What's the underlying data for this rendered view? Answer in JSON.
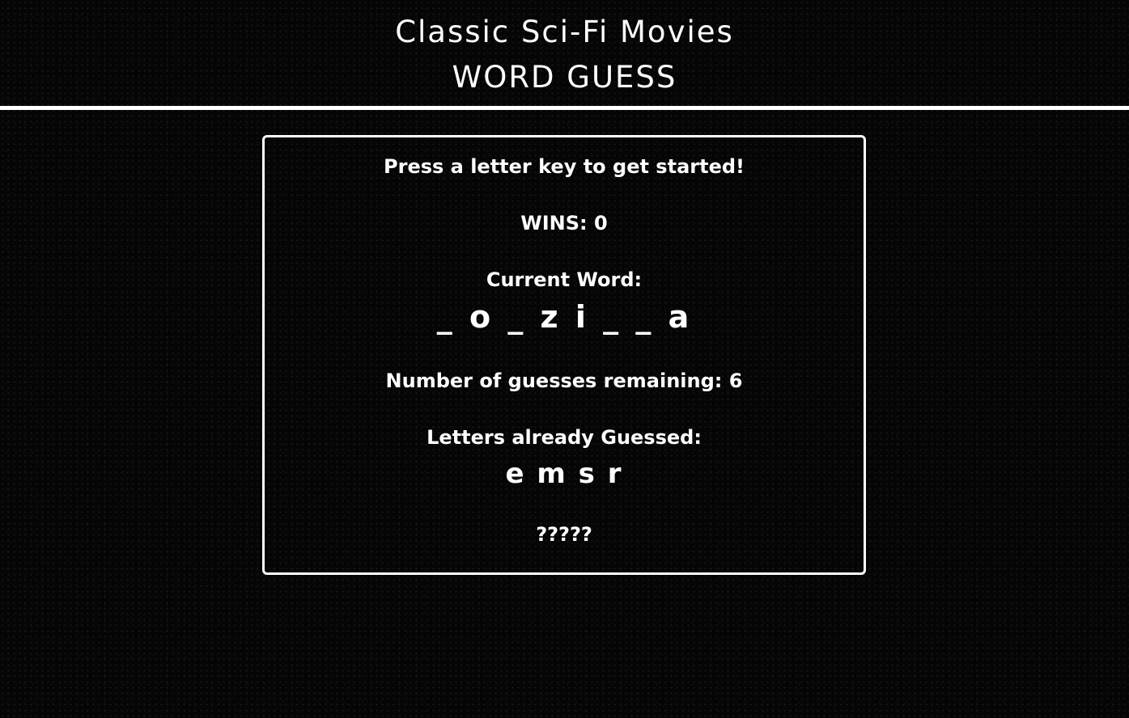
{
  "header": {
    "title": "Classic Sci-Fi Movies",
    "subtitle": "WORD GUESS"
  },
  "game": {
    "instructions": "Press a letter key to get started!",
    "wins_label": "WINS:",
    "wins_value": "0",
    "current_word_label": "Current Word:",
    "current_word": "_ o _ z i _ _ a",
    "guesses_label": "Number of guesses remaining:",
    "guesses_value": "6",
    "guessed_label": "Letters already Guessed:",
    "guessed_letters": "e m s r",
    "mystery_text": "?????"
  }
}
